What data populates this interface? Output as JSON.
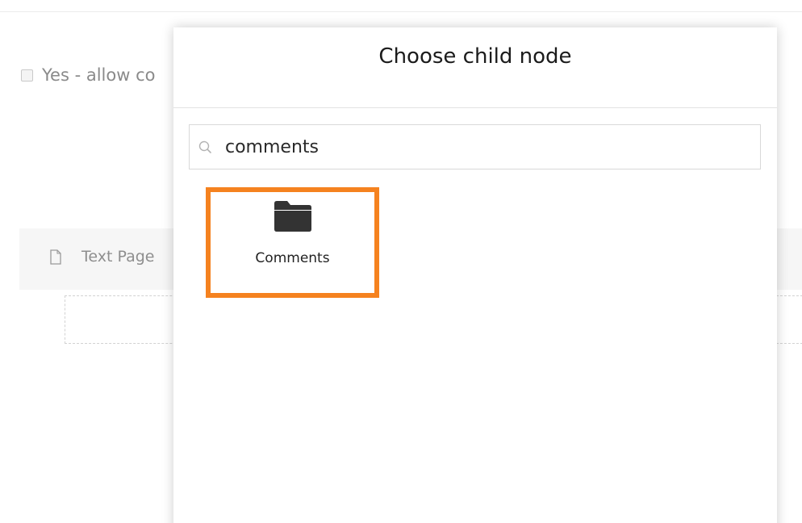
{
  "background": {
    "checkbox_label": "Yes - allow co",
    "row_label": "Text Page"
  },
  "dialog": {
    "title": "Choose child node",
    "search": {
      "value": "comments",
      "placeholder": ""
    },
    "results": [
      {
        "label": "Comments",
        "icon": "folder-icon",
        "selected": true
      }
    ]
  },
  "colors": {
    "selection_border": "#f5821f",
    "title": "#1b1b1b",
    "folder": "#333333"
  }
}
